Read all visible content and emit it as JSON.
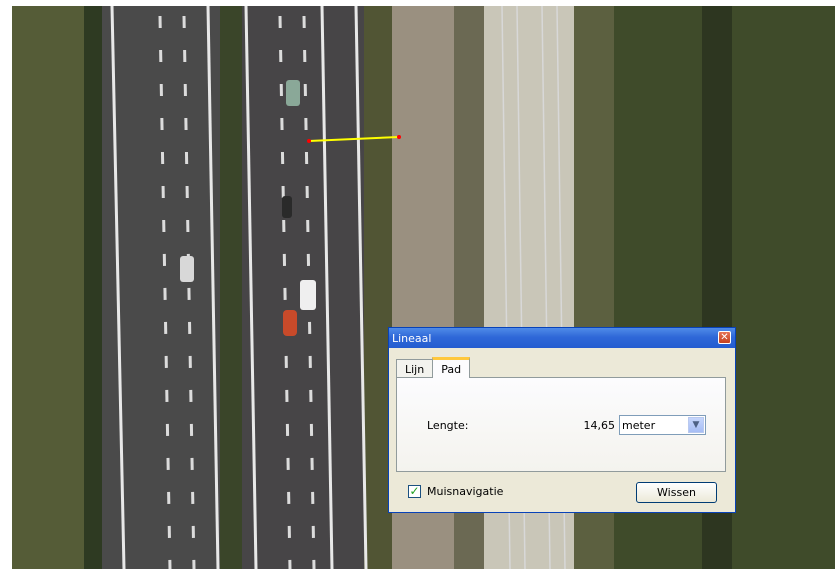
{
  "map": {
    "description_icon": "aerial-photo",
    "measure_line_color": "#ffff00",
    "measure_point_color": "#ff0000"
  },
  "dialog": {
    "title": "Lineaal",
    "close_icon": "close-icon",
    "tabs": [
      {
        "label": "Lijn",
        "active": false
      },
      {
        "label": "Pad",
        "active": true
      }
    ],
    "length_label": "Lengte:",
    "length_value": "14,65",
    "unit_selected": "meter",
    "mouse_nav_label": "Muisnavigatie",
    "mouse_nav_checked": true,
    "clear_button": "Wissen"
  }
}
